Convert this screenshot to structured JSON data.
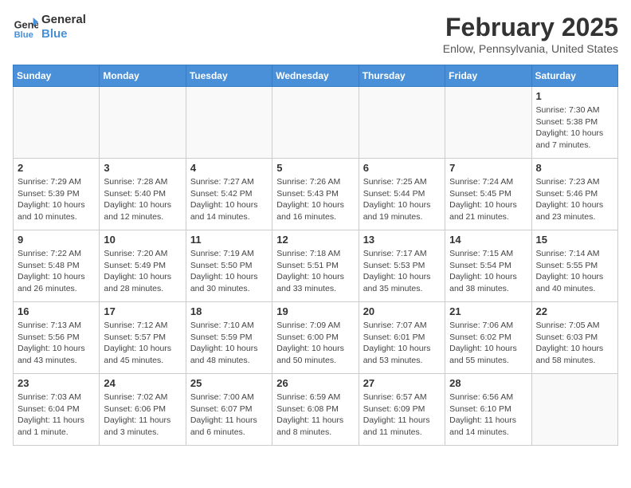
{
  "header": {
    "logo_line1": "General",
    "logo_line2": "Blue",
    "month": "February 2025",
    "location": "Enlow, Pennsylvania, United States"
  },
  "weekdays": [
    "Sunday",
    "Monday",
    "Tuesday",
    "Wednesday",
    "Thursday",
    "Friday",
    "Saturday"
  ],
  "weeks": [
    [
      {
        "day": "",
        "info": ""
      },
      {
        "day": "",
        "info": ""
      },
      {
        "day": "",
        "info": ""
      },
      {
        "day": "",
        "info": ""
      },
      {
        "day": "",
        "info": ""
      },
      {
        "day": "",
        "info": ""
      },
      {
        "day": "1",
        "info": "Sunrise: 7:30 AM\nSunset: 5:38 PM\nDaylight: 10 hours\nand 7 minutes."
      }
    ],
    [
      {
        "day": "2",
        "info": "Sunrise: 7:29 AM\nSunset: 5:39 PM\nDaylight: 10 hours\nand 10 minutes."
      },
      {
        "day": "3",
        "info": "Sunrise: 7:28 AM\nSunset: 5:40 PM\nDaylight: 10 hours\nand 12 minutes."
      },
      {
        "day": "4",
        "info": "Sunrise: 7:27 AM\nSunset: 5:42 PM\nDaylight: 10 hours\nand 14 minutes."
      },
      {
        "day": "5",
        "info": "Sunrise: 7:26 AM\nSunset: 5:43 PM\nDaylight: 10 hours\nand 16 minutes."
      },
      {
        "day": "6",
        "info": "Sunrise: 7:25 AM\nSunset: 5:44 PM\nDaylight: 10 hours\nand 19 minutes."
      },
      {
        "day": "7",
        "info": "Sunrise: 7:24 AM\nSunset: 5:45 PM\nDaylight: 10 hours\nand 21 minutes."
      },
      {
        "day": "8",
        "info": "Sunrise: 7:23 AM\nSunset: 5:46 PM\nDaylight: 10 hours\nand 23 minutes."
      }
    ],
    [
      {
        "day": "9",
        "info": "Sunrise: 7:22 AM\nSunset: 5:48 PM\nDaylight: 10 hours\nand 26 minutes."
      },
      {
        "day": "10",
        "info": "Sunrise: 7:20 AM\nSunset: 5:49 PM\nDaylight: 10 hours\nand 28 minutes."
      },
      {
        "day": "11",
        "info": "Sunrise: 7:19 AM\nSunset: 5:50 PM\nDaylight: 10 hours\nand 30 minutes."
      },
      {
        "day": "12",
        "info": "Sunrise: 7:18 AM\nSunset: 5:51 PM\nDaylight: 10 hours\nand 33 minutes."
      },
      {
        "day": "13",
        "info": "Sunrise: 7:17 AM\nSunset: 5:53 PM\nDaylight: 10 hours\nand 35 minutes."
      },
      {
        "day": "14",
        "info": "Sunrise: 7:15 AM\nSunset: 5:54 PM\nDaylight: 10 hours\nand 38 minutes."
      },
      {
        "day": "15",
        "info": "Sunrise: 7:14 AM\nSunset: 5:55 PM\nDaylight: 10 hours\nand 40 minutes."
      }
    ],
    [
      {
        "day": "16",
        "info": "Sunrise: 7:13 AM\nSunset: 5:56 PM\nDaylight: 10 hours\nand 43 minutes."
      },
      {
        "day": "17",
        "info": "Sunrise: 7:12 AM\nSunset: 5:57 PM\nDaylight: 10 hours\nand 45 minutes."
      },
      {
        "day": "18",
        "info": "Sunrise: 7:10 AM\nSunset: 5:59 PM\nDaylight: 10 hours\nand 48 minutes."
      },
      {
        "day": "19",
        "info": "Sunrise: 7:09 AM\nSunset: 6:00 PM\nDaylight: 10 hours\nand 50 minutes."
      },
      {
        "day": "20",
        "info": "Sunrise: 7:07 AM\nSunset: 6:01 PM\nDaylight: 10 hours\nand 53 minutes."
      },
      {
        "day": "21",
        "info": "Sunrise: 7:06 AM\nSunset: 6:02 PM\nDaylight: 10 hours\nand 55 minutes."
      },
      {
        "day": "22",
        "info": "Sunrise: 7:05 AM\nSunset: 6:03 PM\nDaylight: 10 hours\nand 58 minutes."
      }
    ],
    [
      {
        "day": "23",
        "info": "Sunrise: 7:03 AM\nSunset: 6:04 PM\nDaylight: 11 hours\nand 1 minute."
      },
      {
        "day": "24",
        "info": "Sunrise: 7:02 AM\nSunset: 6:06 PM\nDaylight: 11 hours\nand 3 minutes."
      },
      {
        "day": "25",
        "info": "Sunrise: 7:00 AM\nSunset: 6:07 PM\nDaylight: 11 hours\nand 6 minutes."
      },
      {
        "day": "26",
        "info": "Sunrise: 6:59 AM\nSunset: 6:08 PM\nDaylight: 11 hours\nand 8 minutes."
      },
      {
        "day": "27",
        "info": "Sunrise: 6:57 AM\nSunset: 6:09 PM\nDaylight: 11 hours\nand 11 minutes."
      },
      {
        "day": "28",
        "info": "Sunrise: 6:56 AM\nSunset: 6:10 PM\nDaylight: 11 hours\nand 14 minutes."
      },
      {
        "day": "",
        "info": ""
      }
    ]
  ]
}
